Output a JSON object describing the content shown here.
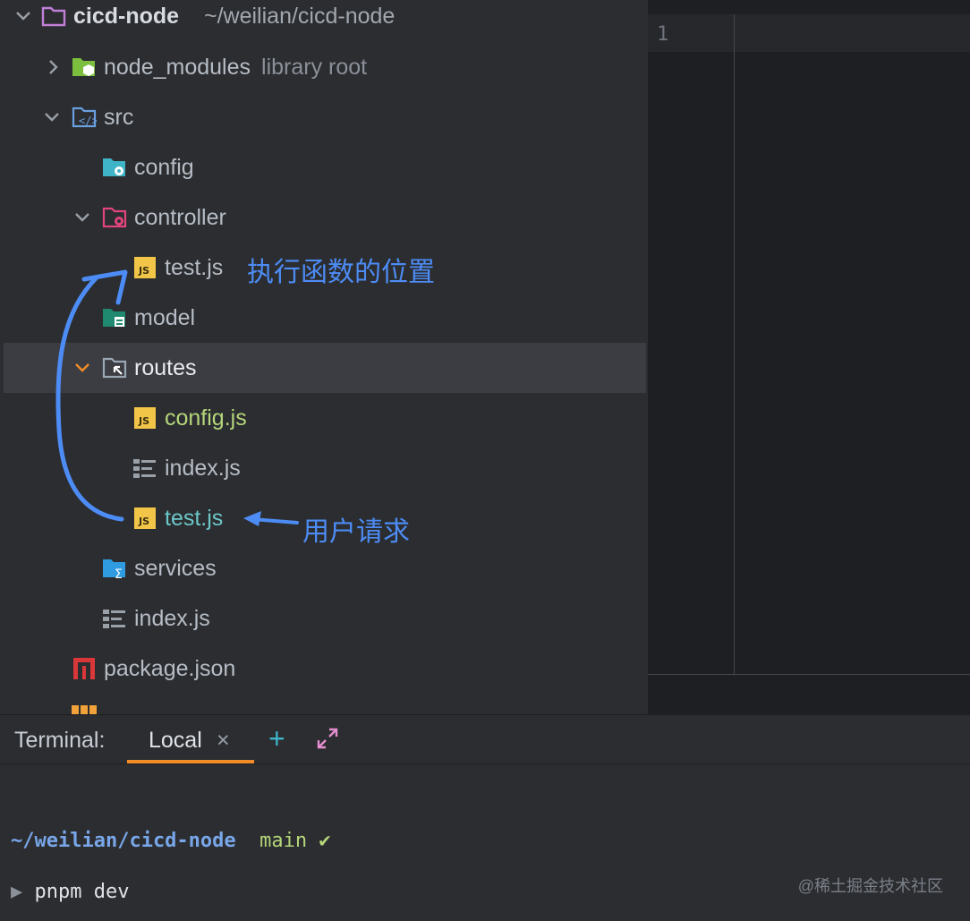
{
  "project": {
    "root_name": "cicd-node",
    "root_path": "~/weilian/cicd-node",
    "items": [
      {
        "label": "node_modules",
        "hint": "library root"
      },
      {
        "label": "src"
      },
      {
        "label": "config"
      },
      {
        "label": "controller"
      },
      {
        "label": "test.js"
      },
      {
        "label": "model"
      },
      {
        "label": "routes"
      },
      {
        "label": "config.js"
      },
      {
        "label": "index.js"
      },
      {
        "label": "test.js"
      },
      {
        "label": "services"
      },
      {
        "label": "index.js"
      },
      {
        "label": "package.json"
      }
    ]
  },
  "editor": {
    "line_number": "1"
  },
  "annotations": {
    "execute": "执行函数的位置",
    "request": "用户请求"
  },
  "terminal": {
    "title": "Terminal:",
    "tab_label": "Local",
    "close_glyph": "×",
    "add_glyph": "+",
    "cwd": "~/weilian/cicd-node",
    "branch": "main",
    "check": "✔",
    "prompt": "▶",
    "command": "pnpm dev"
  },
  "watermark": "@稀土掘金技术社区",
  "colors": {
    "accent_orange": "#f28c28",
    "annotation_blue": "#4d8cf5",
    "js_yellow": "#f2c548"
  }
}
